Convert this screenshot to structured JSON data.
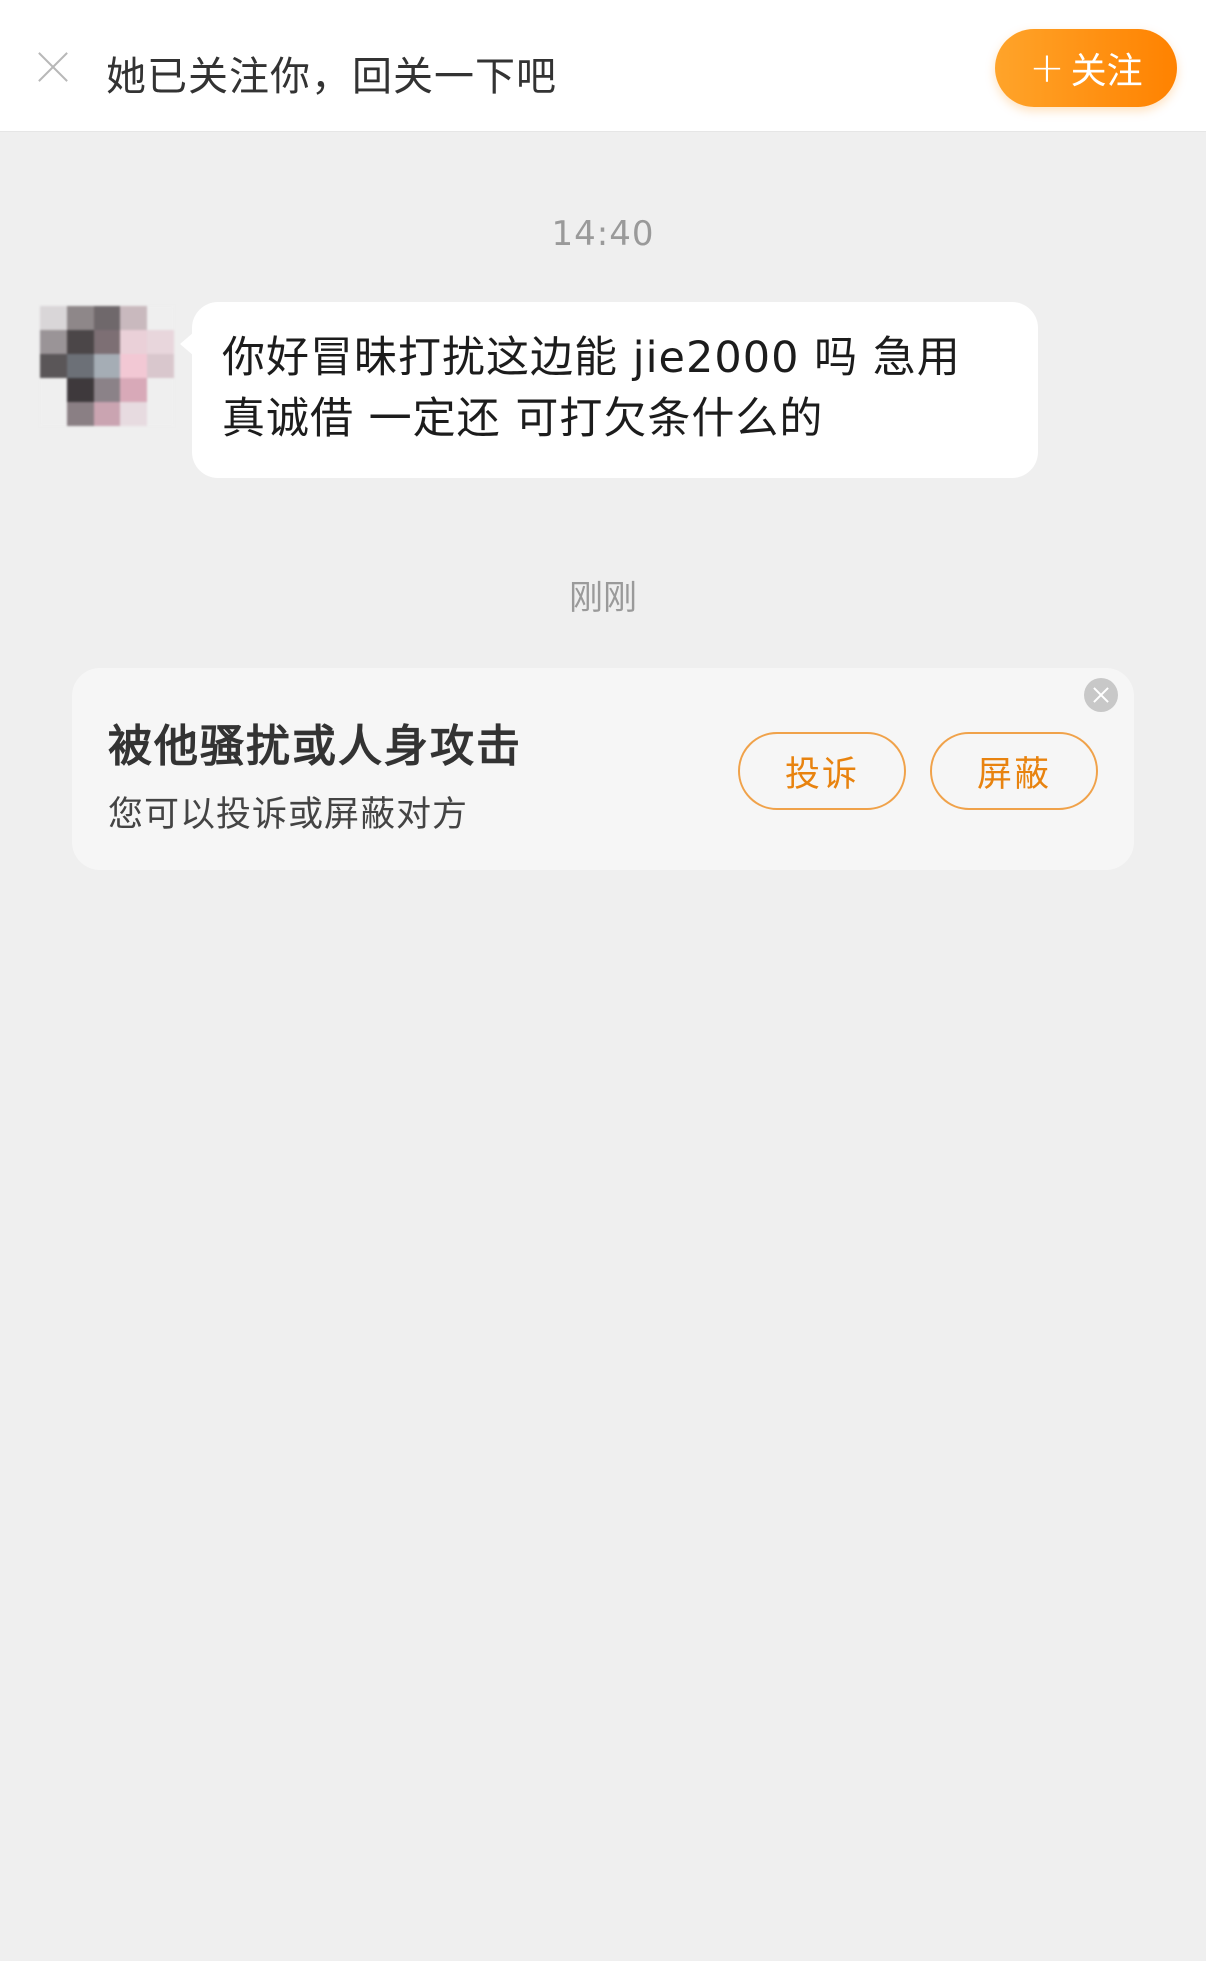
{
  "header": {
    "notice": "她已关注你，回关一下吧",
    "follow_plus": "+",
    "follow_label": "关注"
  },
  "chat": {
    "timestamp_1": "14:40",
    "message_line1": "你好冒昧打扰这边能 jie2000 吗 急用",
    "message_line2": "真诚借 一定还 可打欠条什么的",
    "timestamp_2": "刚刚"
  },
  "safety_card": {
    "title": "被他骚扰或人身攻击",
    "subtitle": "您可以投诉或屏蔽对方",
    "report_label": "投诉",
    "block_label": "屏蔽"
  },
  "colors": {
    "accent": "#ff8c00",
    "pill_border": "#f0a24a",
    "background": "#efefef"
  }
}
